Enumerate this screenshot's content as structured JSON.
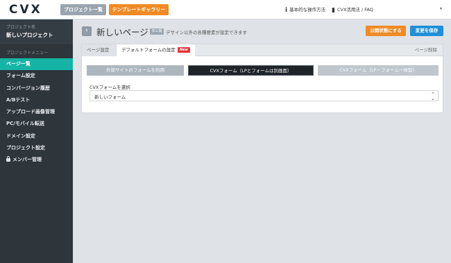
{
  "topbar": {
    "logo": "CVX",
    "projects_button": "プロジェクト一覧",
    "gallery_button": "テンプレートギャラリー",
    "ops_link": "基本的な操作方法",
    "ops_icon": "info-icon",
    "faq_link": "CVX活用法 / FAQ",
    "faq_icon": "book-icon",
    "caret": "▾"
  },
  "sidebar": {
    "project_label": "プロジェクト名",
    "project_name": "新しいプロジェクト",
    "menu_label": "プロジェクトメニュー",
    "items": [
      {
        "label": "ページ一覧",
        "active": true
      },
      {
        "label": "フォーム設定"
      },
      {
        "label": "コンバージョン履歴"
      },
      {
        "label": "A/Bテスト"
      },
      {
        "label": "アップロード画像管理"
      },
      {
        "label": "PC/モバイル転送"
      },
      {
        "label": "ドメイン設定"
      },
      {
        "label": "プロジェクト設定"
      },
      {
        "label": "メンバー管理",
        "icon": "lock-icon"
      }
    ]
  },
  "header": {
    "back": "‹",
    "title": "新しいページ",
    "badge": "非公開",
    "description": "デザイン以外の各種要素が設定できます",
    "publish_button": "公開状態にする",
    "save_button": "変更を保存"
  },
  "panel": {
    "tab_page_settings": "ページ設定",
    "tab_default_form": "デフォルトフォームの設定",
    "tab_new_badge": "New",
    "delete_link": "ページ削除",
    "options": {
      "external": "外部サイトのフォームを利用",
      "cvx_separate": "CVXフォーム（LPとフォームは別画面）",
      "cvx_integrated": "CVXフォーム（LP・フォーム一体型）"
    },
    "select_label": "CVXフォームを選択",
    "select_value": "新しいフォーム"
  },
  "colors": {
    "accent_orange": "#f08a24",
    "accent_blue": "#1f8fd8",
    "sidebar_active": "#16b4a6",
    "sidebar_bg": "#2e353b",
    "new_badge": "#e3343b"
  }
}
